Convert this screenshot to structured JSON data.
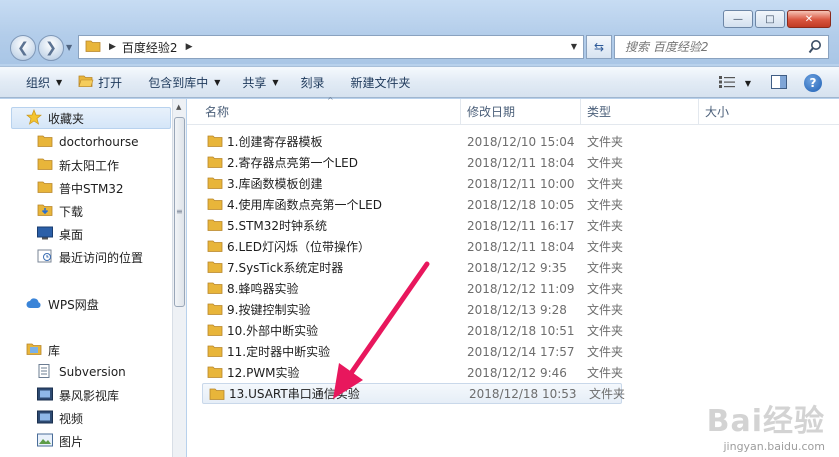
{
  "window": {
    "minimize": "—",
    "maximize": "□",
    "close": "✕"
  },
  "address": {
    "crumb": "百度经验2",
    "search_placeholder": "搜索 百度经验2"
  },
  "toolbar": {
    "organize": "组织",
    "open": "打开",
    "include_in_library": "包含到库中",
    "share": "共享",
    "burn": "刻录",
    "new_folder": "新建文件夹"
  },
  "sidebar": {
    "favorites": "收藏夹",
    "items": [
      {
        "label": "doctorhourse",
        "icon": "folder-icon"
      },
      {
        "label": "新太阳工作",
        "icon": "folder-icon"
      },
      {
        "label": "普中STM32",
        "icon": "folder-icon"
      },
      {
        "label": "下载",
        "icon": "download-folder-icon"
      },
      {
        "label": "桌面",
        "icon": "desktop-icon"
      },
      {
        "label": "最近访问的位置",
        "icon": "recent-places-icon"
      }
    ],
    "wps": "WPS网盘",
    "library": "库",
    "library_items": [
      {
        "label": "Subversion",
        "icon": "document-icon"
      },
      {
        "label": "暴风影视库",
        "icon": "video-icon"
      },
      {
        "label": "视频",
        "icon": "video-icon"
      },
      {
        "label": "图片",
        "icon": "picture-icon"
      }
    ]
  },
  "columns": {
    "name": "名称",
    "date": "修改日期",
    "type": "类型",
    "size": "大小"
  },
  "files": [
    {
      "name": "1.创建寄存器模板",
      "date": "2018/12/10 15:04",
      "type": "文件夹"
    },
    {
      "name": "2.寄存器点亮第一个LED",
      "date": "2018/12/11 18:04",
      "type": "文件夹"
    },
    {
      "name": "3.库函数模板创建",
      "date": "2018/12/11 10:00",
      "type": "文件夹"
    },
    {
      "name": "4.使用库函数点亮第一个LED",
      "date": "2018/12/18 10:05",
      "type": "文件夹"
    },
    {
      "name": "5.STM32时钟系统",
      "date": "2018/12/11 16:17",
      "type": "文件夹"
    },
    {
      "name": "6.LED灯闪烁（位带操作）",
      "date": "2018/12/11 18:04",
      "type": "文件夹"
    },
    {
      "name": "7.SysTick系统定时器",
      "date": "2018/12/12 9:35",
      "type": "文件夹"
    },
    {
      "name": "8.蜂鸣器实验",
      "date": "2018/12/12 11:09",
      "type": "文件夹"
    },
    {
      "name": "9.按键控制实验",
      "date": "2018/12/13 9:28",
      "type": "文件夹"
    },
    {
      "name": "10.外部中断实验",
      "date": "2018/12/18 10:51",
      "type": "文件夹"
    },
    {
      "name": "11.定时器中断实验",
      "date": "2018/12/14 17:57",
      "type": "文件夹"
    },
    {
      "name": "12.PWM实验",
      "date": "2018/12/12 9:46",
      "type": "文件夹"
    },
    {
      "name": "13.USART串口通信实验",
      "date": "2018/12/18 10:53",
      "type": "文件夹"
    }
  ],
  "watermark": {
    "brand": "Bai经验",
    "url": "jingyan.baidu.com"
  },
  "colors": {
    "arrow": "#e8175d",
    "folder": "#e8b53a",
    "selection": "#d5e6f8"
  }
}
